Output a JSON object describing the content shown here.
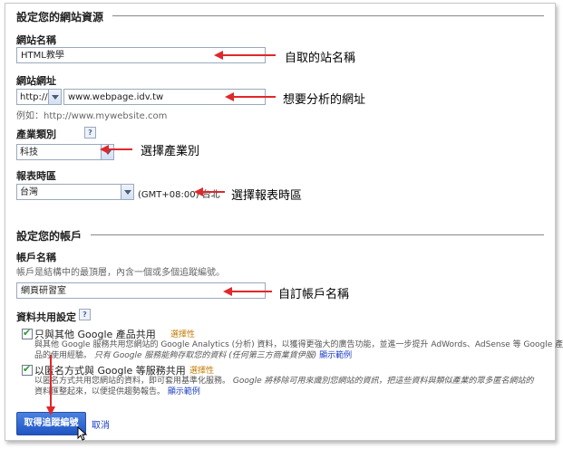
{
  "site_section": {
    "title": "設定您的網站資源",
    "site_name_label": "網站名稱",
    "site_name_value": "HTML教學",
    "site_url_label": "網站網址",
    "protocol": "http://",
    "url_value": "www.webpage.idv.tw",
    "url_example": "例如：http://www.mywebsite.com",
    "industry_label": "產業類別",
    "industry_value": "科技",
    "timezone_label": "報表時區",
    "timezone_country": "台灣",
    "timezone_offset": "(GMT+08:00) 台北"
  },
  "account_section": {
    "title": "設定您的帳戶",
    "account_name_label": "帳戶名稱",
    "account_hint": "帳戶是結構中的最頂層，內含一個或多個追蹤編號。",
    "account_name_value": "網頁研習室",
    "sharing_label": "資料共用設定",
    "share_google": {
      "title": "只與其他 Google 產品共用",
      "optional": "選擇性",
      "desc_line1": "與其他 Google 服務共用您網站的 Google Analytics (分析) 資料，以獲得更強大的廣告功能，並進一步提升 AdWords、AdSense 等 Google 產",
      "desc_line2_start": "品的使用經驗。",
      "desc_line2_italic": "只有 Google 服務能夠存取您的資料 (任何第三方商業貨伊服)"
    },
    "share_anonymous": {
      "title": "以匿名方式與 Google 等服務共用",
      "optional": "選擇性",
      "desc_line1_start": "以匿名方式共用您網站的資料，即可套用基準化服務。",
      "desc_line1_italic": "Google 將移除可用來識別您網站的資訊，把這些資料與類似產業的眾多匿名網站的",
      "desc_line2": "資料匯整起來，以便提供趨勢報告。",
      "show_example": "顯示範例"
    },
    "show_example": "顯示範例"
  },
  "actions": {
    "get_tracking_id": "取得追蹤編號",
    "cancel": "取消"
  },
  "annotations": {
    "site_name": "自取的站名稱",
    "url": "想要分析的網址",
    "industry": "選擇產業別",
    "timezone": "選擇報表時區",
    "account": "自訂帳戶名稱"
  },
  "colors": {
    "arrow": "#e0282c",
    "link": "#1a3dc1",
    "button": "#1f55c4",
    "optional": "#c17a00",
    "check": "#2f9a2f"
  }
}
